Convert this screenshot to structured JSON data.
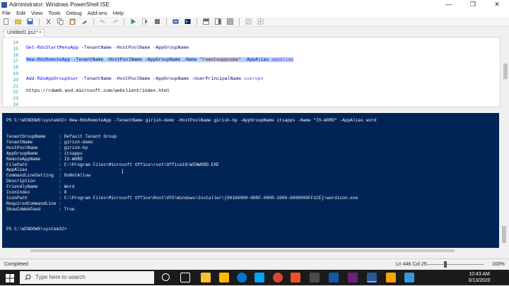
{
  "window": {
    "title": "Administrator: Windows PowerShell ISE",
    "minimize": "—",
    "maximize": "❐",
    "close": "✕"
  },
  "menu": [
    "File",
    "Edit",
    "View",
    "Tools",
    "Debug",
    "Add-ons",
    "Help"
  ],
  "tab": {
    "label": "Untitled1.ps1*",
    "close": "×"
  },
  "editor": {
    "lines": [
      {
        "n": "14",
        "text": ""
      },
      {
        "n": "15",
        "cmd": "Get-RdsStartMenuApp",
        "params": " -TenantName -HostPoolName -AppGroupName"
      },
      {
        "n": "16",
        "text": ""
      },
      {
        "n": "17",
        "cmd": "New-RdsRemoteApp",
        "params": " -TenantName -HostPoolName -AppGroupName -Name ",
        "str": "\"remoteappname\"",
        "params2": " -AppAlias ",
        "var": "appalias"
      },
      {
        "n": "18",
        "text": ""
      },
      {
        "n": "19",
        "text": ""
      },
      {
        "n": "20",
        "cmd": "Add-RdsAppGroupUser",
        "params": " -TenantName -HostPoolName -AppGroupName -UserPrincipalName ",
        "var": "userupn"
      },
      {
        "n": "21",
        "text": ""
      },
      {
        "n": "22",
        "url": "https://rdweb.wvd.microsoft.com/webclient/index.html"
      },
      {
        "n": "23",
        "text": ""
      },
      {
        "n": "24",
        "text": ""
      }
    ]
  },
  "console": {
    "prompt_cmd": "PS C:\\WINDOWS\\system32> New-RdsRemoteApp -TenantName girish-demo -HostPoolName girish-hp -AppGroupName itsapps -Name \"IS-WORD\" -AppAlias word",
    "output": [
      "TenantGroupName     : Default Tenant Group",
      "TenantName          : girish-demo",
      "HostPoolName        : girish-hp",
      "AppGroupName        : itsapps",
      "RemoteAppName       : IS-WORD",
      "FilePath            : C:\\Program Files\\Microsoft Office\\root\\Office16\\WINWORD.EXE",
      "AppAlias            :",
      "CommandLineSetting  : DoNotAllow",
      "Description         :",
      "FriendlyName        : Word",
      "IconIndex           : 0",
      "IconPath            : C:\\Program Files\\Microsoft Office\\Root\\VFS\\Windows\\Installer\\{90160000-000F-0000-1000-0000000FF1CE}\\wordicon.exe",
      "RequiredCommandLine :",
      "ShowInWebFeed       : True"
    ],
    "final_prompt": "PS C:\\WINDOWS\\system32>"
  },
  "status": {
    "text": "Completed",
    "position": "Ln 446  Col 25",
    "zoom": "100%",
    "zoom_level_percent": 100
  },
  "taskbar": {
    "search_placeholder": "Type here to search",
    "time": "10:43 AM",
    "date": "3/13/2020"
  }
}
